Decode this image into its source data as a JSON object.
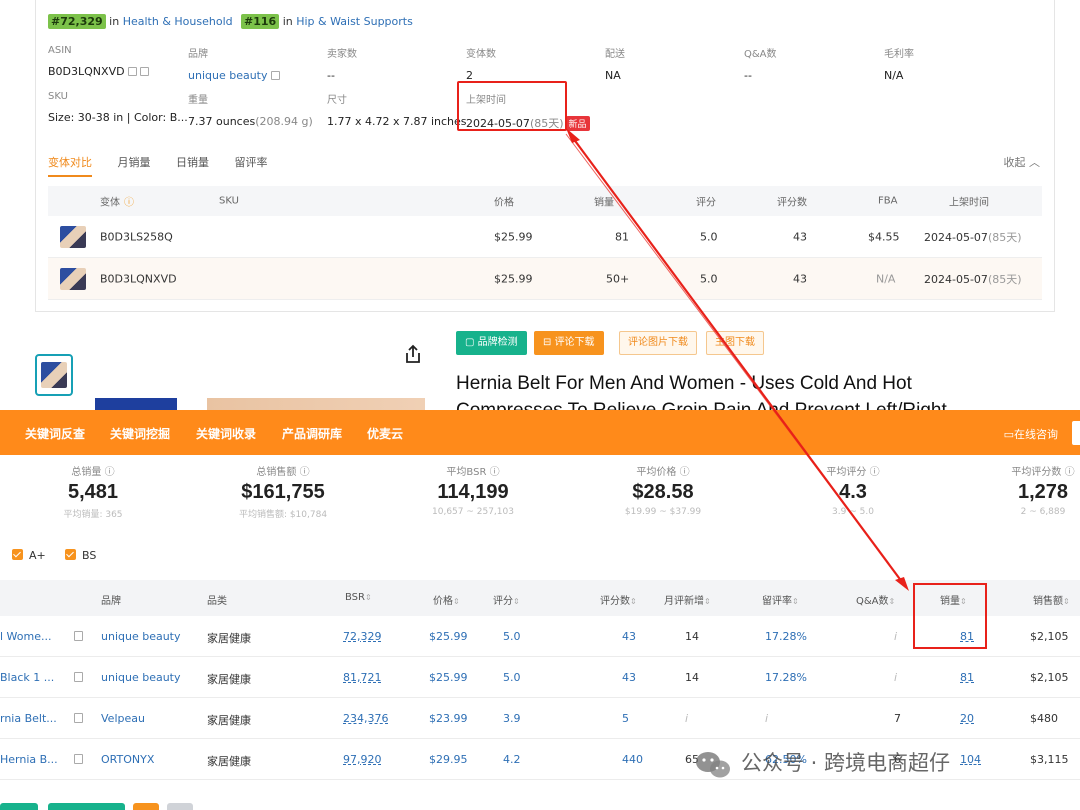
{
  "top": {
    "ranks": [
      {
        "badge": "#72,329",
        "in": "in",
        "category": "Health & Household"
      },
      {
        "badge": "#116",
        "in": "in",
        "category": "Hip & Waist Supports"
      }
    ],
    "fields": {
      "asin": {
        "label": "ASIN",
        "value": "B0D3LQNXVD"
      },
      "brand": {
        "label": "品牌",
        "value": "unique beauty"
      },
      "sellers": {
        "label": "卖家数",
        "value": "--"
      },
      "variants": {
        "label": "变体数",
        "value": "2"
      },
      "delivery": {
        "label": "配送",
        "value": "NA"
      },
      "qa": {
        "label": "Q&A数",
        "value": "--"
      },
      "margin": {
        "label": "毛利率",
        "value": "N/A"
      },
      "sku": {
        "label": "SKU",
        "value": "Size: 30-38 in | Color: B..."
      },
      "weight": {
        "label": "重量",
        "value": "7.37 ounces",
        "sub": "(208.94 g)"
      },
      "size": {
        "label": "尺寸",
        "value": "1.77 x 4.72 x 7.87 inches"
      },
      "listed": {
        "label": "上架时间",
        "value": "2024-05-07",
        "sub": "(85天)",
        "badge": "新品"
      }
    },
    "tabs": [
      "变体对比",
      "月销量",
      "日销量",
      "留评率"
    ],
    "collapse": "收起",
    "variant_table": {
      "headers": [
        "变体",
        "SKU",
        "价格",
        "销量",
        "评分",
        "评分数",
        "FBA",
        "上架时间"
      ],
      "rows": [
        {
          "asin": "B0D3LS258Q",
          "price": "$25.99",
          "sales": "81",
          "rating": "5.0",
          "reviews": "43",
          "fba": "$4.55",
          "date": "2024-05-07",
          "days": "(85天)"
        },
        {
          "asin": "B0D3LQNXVD",
          "price": "$25.99",
          "sales": "50+",
          "rating": "5.0",
          "reviews": "43",
          "fba": "N/A",
          "date": "2024-05-07",
          "days": "(85天)"
        }
      ]
    },
    "buttons": [
      "品牌检测",
      "评论下载",
      "评论图片下载",
      "主图下载"
    ],
    "product_title": "Hernia Belt For Men And Women - Uses Cold And Hot Compresses To Relieve Groin Pain And Prevent Left/Right"
  },
  "bottom": {
    "nav": [
      "关键词反查",
      "关键词挖掘",
      "关键词收录",
      "产品调研库",
      "优麦云"
    ],
    "consult": "在线咨询",
    "stats": [
      {
        "label": "总销量",
        "value": "5,481",
        "sub": "平均销量: 365"
      },
      {
        "label": "总销售额",
        "value": "$161,755",
        "sub": "平均销售额: $10,784"
      },
      {
        "label": "平均BSR",
        "value": "114,199",
        "sub": "10,657 ~ 257,103"
      },
      {
        "label": "平均价格",
        "value": "$28.58",
        "sub": "$19.99 ~ $37.99"
      },
      {
        "label": "平均评分",
        "value": "4.3",
        "sub": "3.9 ~ 5.0"
      },
      {
        "label": "平均评分数",
        "value": "1,278",
        "sub": "2 ~ 6,889"
      }
    ],
    "filters": [
      "A+",
      "BS"
    ],
    "headers": [
      "品牌",
      "品类",
      "BSR",
      "价格",
      "评分",
      "评分数",
      "月评新增",
      "留评率",
      "Q&A数",
      "销量",
      "销售额"
    ],
    "rows": [
      {
        "title": "l Wome...",
        "brand": "unique beauty",
        "category": "家居健康",
        "bsr": "72,329",
        "price": "$25.99",
        "rating": "5.0",
        "reviews": "43",
        "new_reviews": "14",
        "review_rate": "17.28%",
        "qa": "i",
        "sales": "81",
        "revenue": "$2,105"
      },
      {
        "title": "Black 1 ...",
        "brand": "unique beauty",
        "category": "家居健康",
        "bsr": "81,721",
        "price": "$25.99",
        "rating": "5.0",
        "reviews": "43",
        "new_reviews": "14",
        "review_rate": "17.28%",
        "qa": "i",
        "sales": "81",
        "revenue": "$2,105"
      },
      {
        "title": "rnia Belt...",
        "brand": "Velpeau",
        "category": "家居健康",
        "bsr": "234,376",
        "price": "$23.99",
        "rating": "3.9",
        "reviews": "5",
        "new_reviews": "i",
        "review_rate": "i",
        "qa": "7",
        "sales": "20",
        "revenue": "$480"
      },
      {
        "title": "Hernia B...",
        "brand": "ORTONYX",
        "category": "家居健康",
        "bsr": "97,920",
        "price": "$29.95",
        "rating": "4.2",
        "reviews": "440",
        "new_reviews": "65",
        "review_rate": "62.50%",
        "qa": "6",
        "sales": "104",
        "revenue": "$3,115"
      }
    ]
  },
  "watermark": "公众号 · 跨境电商超仔",
  "colors": {
    "accent_orange": "#ff8a1a",
    "highlight_red": "#e8211a",
    "link_blue": "#2e6fb5",
    "green": "#17b28c"
  }
}
